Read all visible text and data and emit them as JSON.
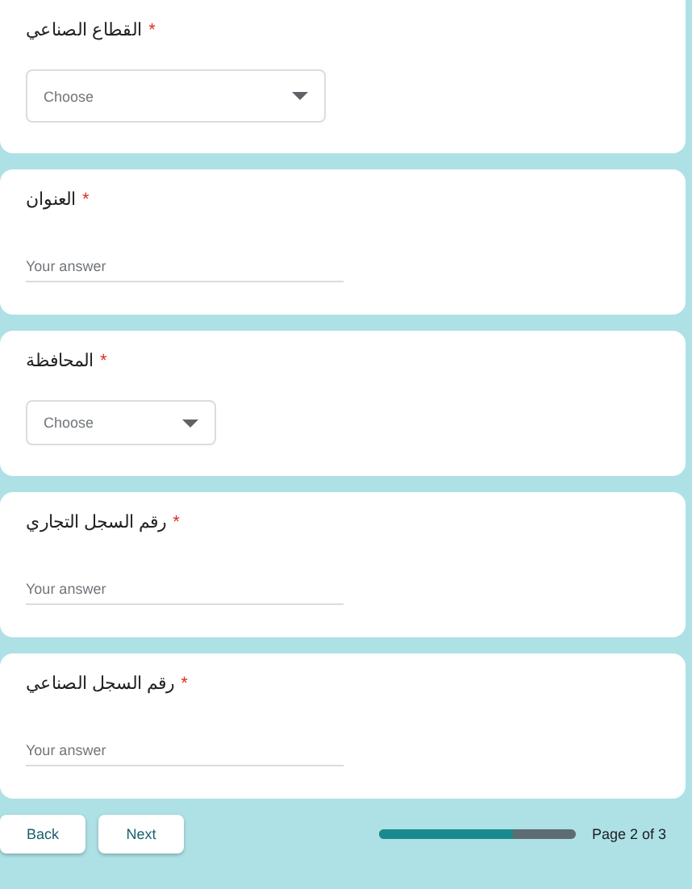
{
  "questions": [
    {
      "kind": "dropdown",
      "title": "القطاع الصناعي",
      "required_mark": "*",
      "placeholder": "Choose"
    },
    {
      "kind": "text",
      "title": "العنوان",
      "required_mark": "*",
      "placeholder": "Your answer"
    },
    {
      "kind": "dropdown",
      "title": "المحافظة",
      "required_mark": "*",
      "placeholder": "Choose"
    },
    {
      "kind": "text",
      "title": "رقم السجل التجاري",
      "required_mark": "*",
      "placeholder": "Your answer"
    },
    {
      "kind": "text",
      "title": "رقم السجل الصناعي",
      "required_mark": "*",
      "placeholder": "Your answer"
    }
  ],
  "back_button": "Back",
  "next_button": "Next",
  "progress": {
    "level": 0.68,
    "label": "Page 2 of 3"
  }
}
